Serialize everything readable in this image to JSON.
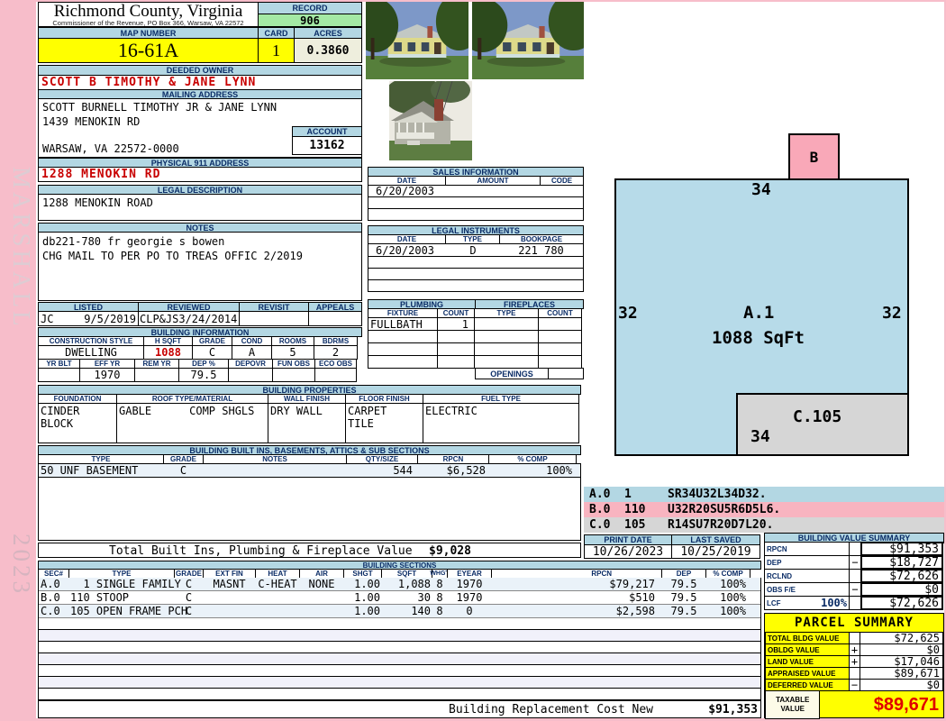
{
  "sidebar": {
    "vendor": "MARSHALL",
    "year": "2023"
  },
  "header": {
    "county": "Richmond County, Virginia",
    "commissioner": "Commissioner of the Revenue, PO Box 366, Warsaw, VA 22572",
    "record_label": "RECORD",
    "record": "906",
    "map_number_label": "MAP NUMBER",
    "map_number": "16-61A",
    "card_label": "CARD",
    "card": "1",
    "acres_label": "ACRES",
    "acres": "0.3860"
  },
  "owner": {
    "deeded_owner_label": "DEEDED OWNER",
    "deeded_owner": "SCOTT B TIMOTHY & JANE LYNN",
    "mailing_label": "MAILING ADDRESS",
    "mailing_line1": "SCOTT BURNELL TIMOTHY JR & JANE LYNN",
    "mailing_line2": "1439 MENOKIN RD",
    "mailing_line3": "WARSAW, VA 22572-0000",
    "account_label": "ACCOUNT",
    "account": "13162",
    "physical_label": "PHYSICAL 911 ADDRESS",
    "physical_address": "1288 MENOKIN RD",
    "legal_label": "LEGAL DESCRIPTION",
    "legal_description": "1288 MENOKIN ROAD"
  },
  "notes": {
    "label": "NOTES",
    "line1": "db221-780 fr georgie s bowen",
    "line2": "CHG MAIL TO PER PO TO TREAS OFFIC 2/2019"
  },
  "review": {
    "headers": [
      "LISTED",
      "REVIEWED",
      "REVISIT",
      "APPEALS"
    ],
    "listed_by": "JC",
    "listed_date": "9/5/2019",
    "reviewed_by": "CLP&JS",
    "reviewed_date": "3/24/2014",
    "revisit": "",
    "appeals": ""
  },
  "building_information": {
    "label": "BUILDING INFORMATION",
    "row1_headers": [
      "CONSTRUCTION STYLE",
      "H SQFT",
      "GRADE",
      "COND",
      "ROOMS",
      "BDRMS"
    ],
    "row1_values": [
      "DWELLING",
      "1088",
      "C",
      "A",
      "5",
      "2"
    ],
    "row2_headers": [
      "YR BLT",
      "EFF YR",
      "REM YR",
      "DEP %",
      "DEPOVR",
      "FUN OBS",
      "ECO OBS"
    ],
    "row2_values": [
      "",
      "1970",
      "",
      "79.5",
      "",
      "",
      ""
    ]
  },
  "building_properties": {
    "label": "BUILDING PROPERTIES",
    "headers": [
      "FOUNDATION",
      "ROOF TYPE/MATERIAL",
      "WALL FINISH",
      "FLOOR FINISH",
      "FUEL TYPE"
    ],
    "foundation": "CINDER BLOCK",
    "roof_type": "GABLE",
    "roof_material": "COMP SHGLS",
    "wall_finish": "DRY WALL",
    "floor_finish_line1": "CARPET",
    "floor_finish_line2": "TILE",
    "fuel_type": "ELECTRIC"
  },
  "built_ins": {
    "label": "BUILDING BUILT INS, BASEMENTS, ATTICS & SUB SECTIONS",
    "headers": [
      "TYPE",
      "GRADE",
      "NOTES",
      "QTY/SIZE",
      "RPCN",
      "% COMP"
    ],
    "row": [
      "50 UNF BASEMENT",
      "C",
      "",
      "544",
      "$6,528",
      "100%"
    ],
    "total_label": "Total Built Ins, Plumbing & Fireplace Value",
    "total_value": "$9,028"
  },
  "sales": {
    "label": "SALES INFORMATION",
    "headers": [
      "DATE",
      "AMOUNT",
      "CODE"
    ],
    "rows": [
      [
        "6/20/2003",
        "",
        ""
      ],
      [
        "",
        "",
        ""
      ],
      [
        "",
        "",
        ""
      ]
    ]
  },
  "legal_instruments": {
    "label": "LEGAL INSTRUMENTS",
    "headers": [
      "DATE",
      "TYPE",
      "BOOKPAGE"
    ],
    "rows": [
      [
        "6/20/2003",
        "D",
        "221 780"
      ],
      [
        "",
        "",
        ""
      ],
      [
        "",
        "",
        ""
      ],
      [
        "",
        "",
        ""
      ]
    ]
  },
  "plumbing": {
    "label": "PLUMBING",
    "headers": [
      "FIXTURE",
      "COUNT"
    ],
    "rows": [
      [
        "FULLBATH",
        "1"
      ],
      [
        "",
        ""
      ],
      [
        "",
        ""
      ],
      [
        "",
        ""
      ]
    ]
  },
  "fireplaces": {
    "label": "FIREPLACES",
    "headers": [
      "TYPE",
      "COUNT"
    ],
    "rows": [
      [
        "",
        ""
      ],
      [
        "",
        ""
      ],
      [
        "",
        ""
      ],
      [
        "",
        ""
      ]
    ],
    "openings_label": "OPENINGS",
    "openings_value": ""
  },
  "sketch": {
    "b_label": "B",
    "a_label": "A.1",
    "a_sqft": "1088 SqFt",
    "dim_top": "34",
    "dim_left": "32",
    "dim_right": "32",
    "dim_bottom": "34",
    "c_label": "C.105",
    "legend": [
      {
        "code": "A.0",
        "num": "1",
        "vector": "SR34U32L34D32."
      },
      {
        "code": "B.0",
        "num": "110",
        "vector": "U32R20SU5R6D5L6."
      },
      {
        "code": "C.0",
        "num": "105",
        "vector": "R14SU7R20D7L20."
      }
    ]
  },
  "print_info": {
    "print_date_label": "PRINT DATE",
    "print_date": "10/26/2023",
    "last_saved_label": "LAST SAVED",
    "last_saved": "10/25/2019"
  },
  "building_value_summary": {
    "label": "BUILDING VALUE SUMMARY",
    "rows": [
      {
        "label": "RPCN",
        "extra": "",
        "sign": "",
        "value": "$91,353"
      },
      {
        "label": "DEP",
        "extra": "",
        "sign": "−",
        "value": "$18,727"
      },
      {
        "label": "RCLND",
        "extra": "",
        "sign": "",
        "value": "$72,626"
      },
      {
        "label": "OBS F/E",
        "extra": "",
        "sign": "−",
        "value": "$0"
      },
      {
        "label": "LCF",
        "extra": "100%",
        "sign": "",
        "value": "$72,626"
      }
    ]
  },
  "building_sections": {
    "label": "BUILDING SECTIONS",
    "headers": [
      "SEC#",
      "TYPE",
      "GRADE",
      "EXT FIN",
      "HEAT",
      "AIR",
      "SHGT",
      "SQFT",
      "WHGT",
      "EYEAR",
      "RPCN",
      "DEP",
      "% COMP"
    ],
    "rows": [
      [
        "A.0",
        "  1 SINGLE FAMILY",
        "C",
        "MASNT",
        "C-HEAT",
        "NONE",
        "1.00",
        "1,088",
        "8",
        "1970",
        "$79,217",
        "79.5",
        "100%"
      ],
      [
        "B.0",
        "110 STOOP",
        "C",
        "",
        "",
        "",
        "1.00",
        "30",
        "8",
        "1970",
        "$510",
        "79.5",
        "100%"
      ],
      [
        "C.0",
        "105 OPEN FRAME PCH",
        "C",
        "",
        "",
        "",
        "1.00",
        "140",
        "8",
        "0",
        "$2,598",
        "79.5",
        "100%"
      ]
    ],
    "replacement_label": "Building Replacement Cost New",
    "replacement_value": "$91,353"
  },
  "parcel_summary": {
    "label": "PARCEL SUMMARY",
    "rows": [
      {
        "label": "TOTAL BLDG VALUE",
        "sign": "",
        "value": "$72,625"
      },
      {
        "label": "OBLDG VALUE",
        "sign": "+",
        "value": "$0"
      },
      {
        "label": "LAND VALUE",
        "sign": "+",
        "value": "$17,046"
      },
      {
        "label": "APPRAISED VALUE",
        "sign": "",
        "value": "$89,671"
      },
      {
        "label": "DEFERRED VALUE",
        "sign": "−",
        "value": "$0"
      }
    ],
    "taxable_label": "TAXABLE VALUE",
    "taxable_value": "$89,671"
  },
  "colors": {
    "header_blue": "#b3d7e3",
    "record_green": "#a4e9a4",
    "highlight_yellow": "#ffff00",
    "sketch_blue": "#b7dbe9",
    "sketch_pink": "#f9a8b8",
    "sketch_gray": "#d6d6d6",
    "alert_red": "#c80000",
    "page_pink": "#f7bdca"
  }
}
